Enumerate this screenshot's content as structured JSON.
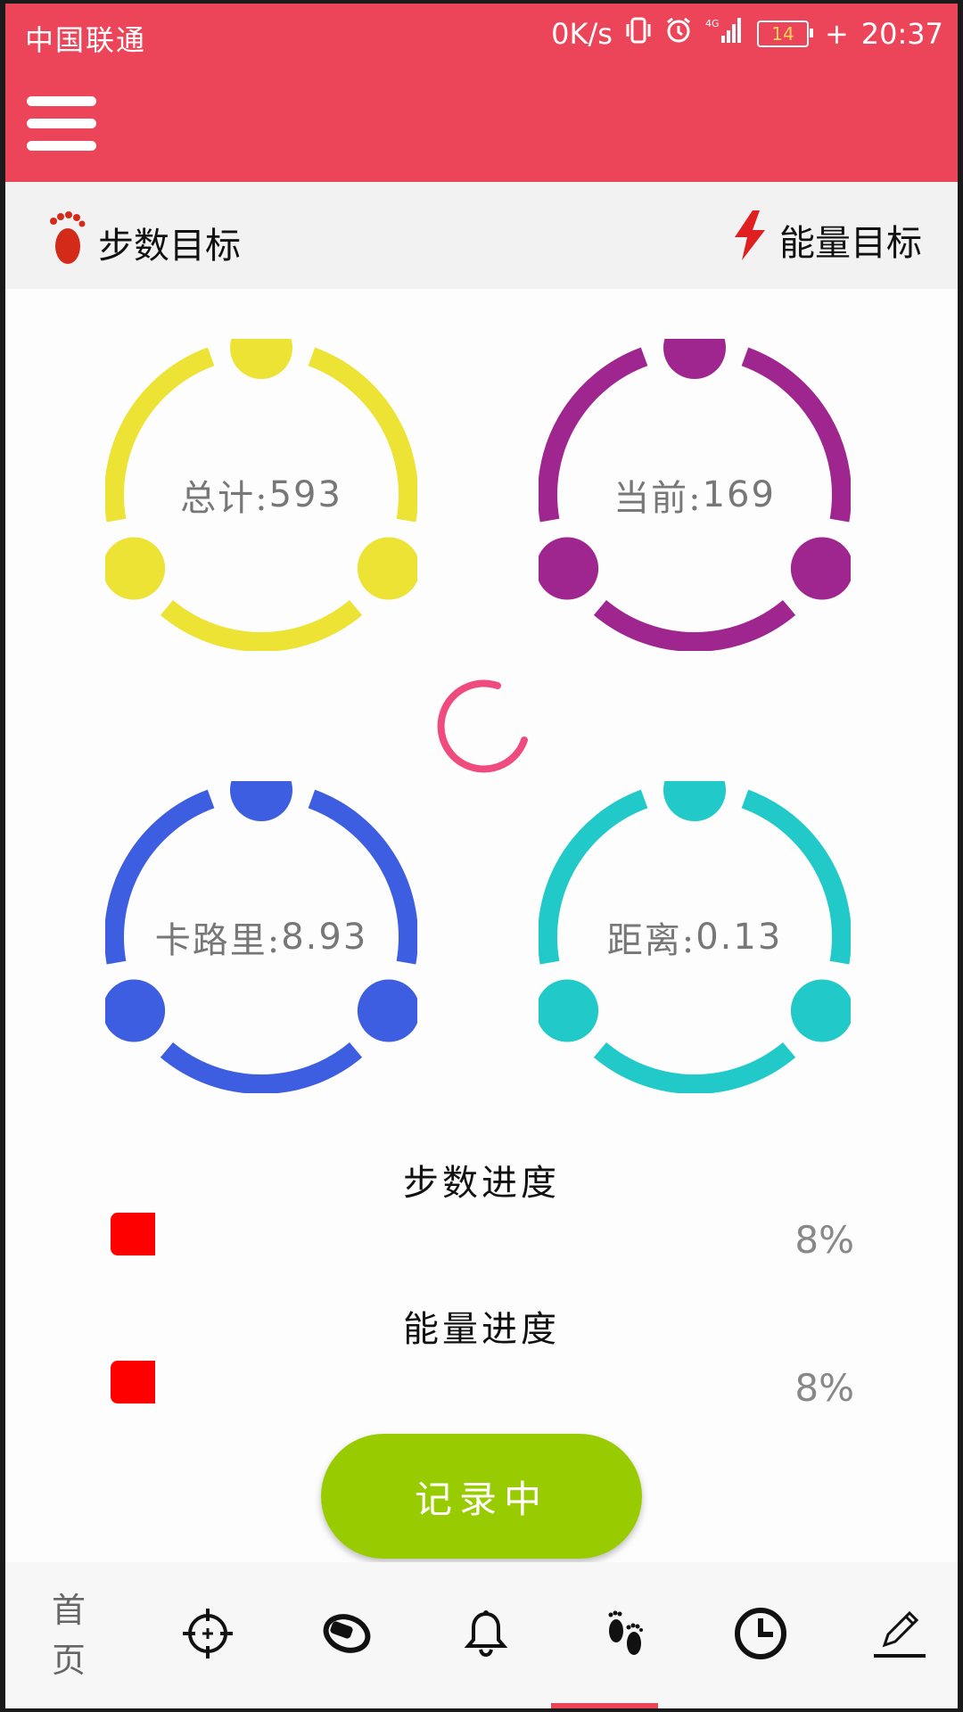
{
  "status_bar": {
    "carrier": "中国联通",
    "speed": "0K/s",
    "network": "4G",
    "battery": "14",
    "time": "20:37"
  },
  "colors": {
    "primary": "#ec4459",
    "steps_ring": "#ece334",
    "current_ring": "#a0268f",
    "calorie_ring": "#3d5ee0",
    "distance_ring": "#21cac8",
    "spinner": "#f04b7e",
    "progress_fill": "#ff0000",
    "record_button": "#99cc00"
  },
  "goals": {
    "steps_label": "步数目标",
    "energy_label": "能量目标"
  },
  "rings": {
    "total": {
      "key": "总计:",
      "value": "593"
    },
    "current": {
      "key": "当前:",
      "value": "169"
    },
    "calories": {
      "key": "卡路里:",
      "value": "8.93"
    },
    "distance": {
      "key": "距离:",
      "value": "0.13"
    }
  },
  "progress": {
    "steps_title": "步数进度",
    "steps_percent": "8%",
    "steps_fraction": 0.08,
    "energy_title": "能量进度",
    "energy_percent": "8%",
    "energy_fraction": 0.08
  },
  "record_button": "记录中",
  "bottom_nav": {
    "home": "首页",
    "icons": [
      "target-icon",
      "band-icon",
      "bell-icon",
      "footprints-icon",
      "clock-icon",
      "edit-icon"
    ]
  }
}
